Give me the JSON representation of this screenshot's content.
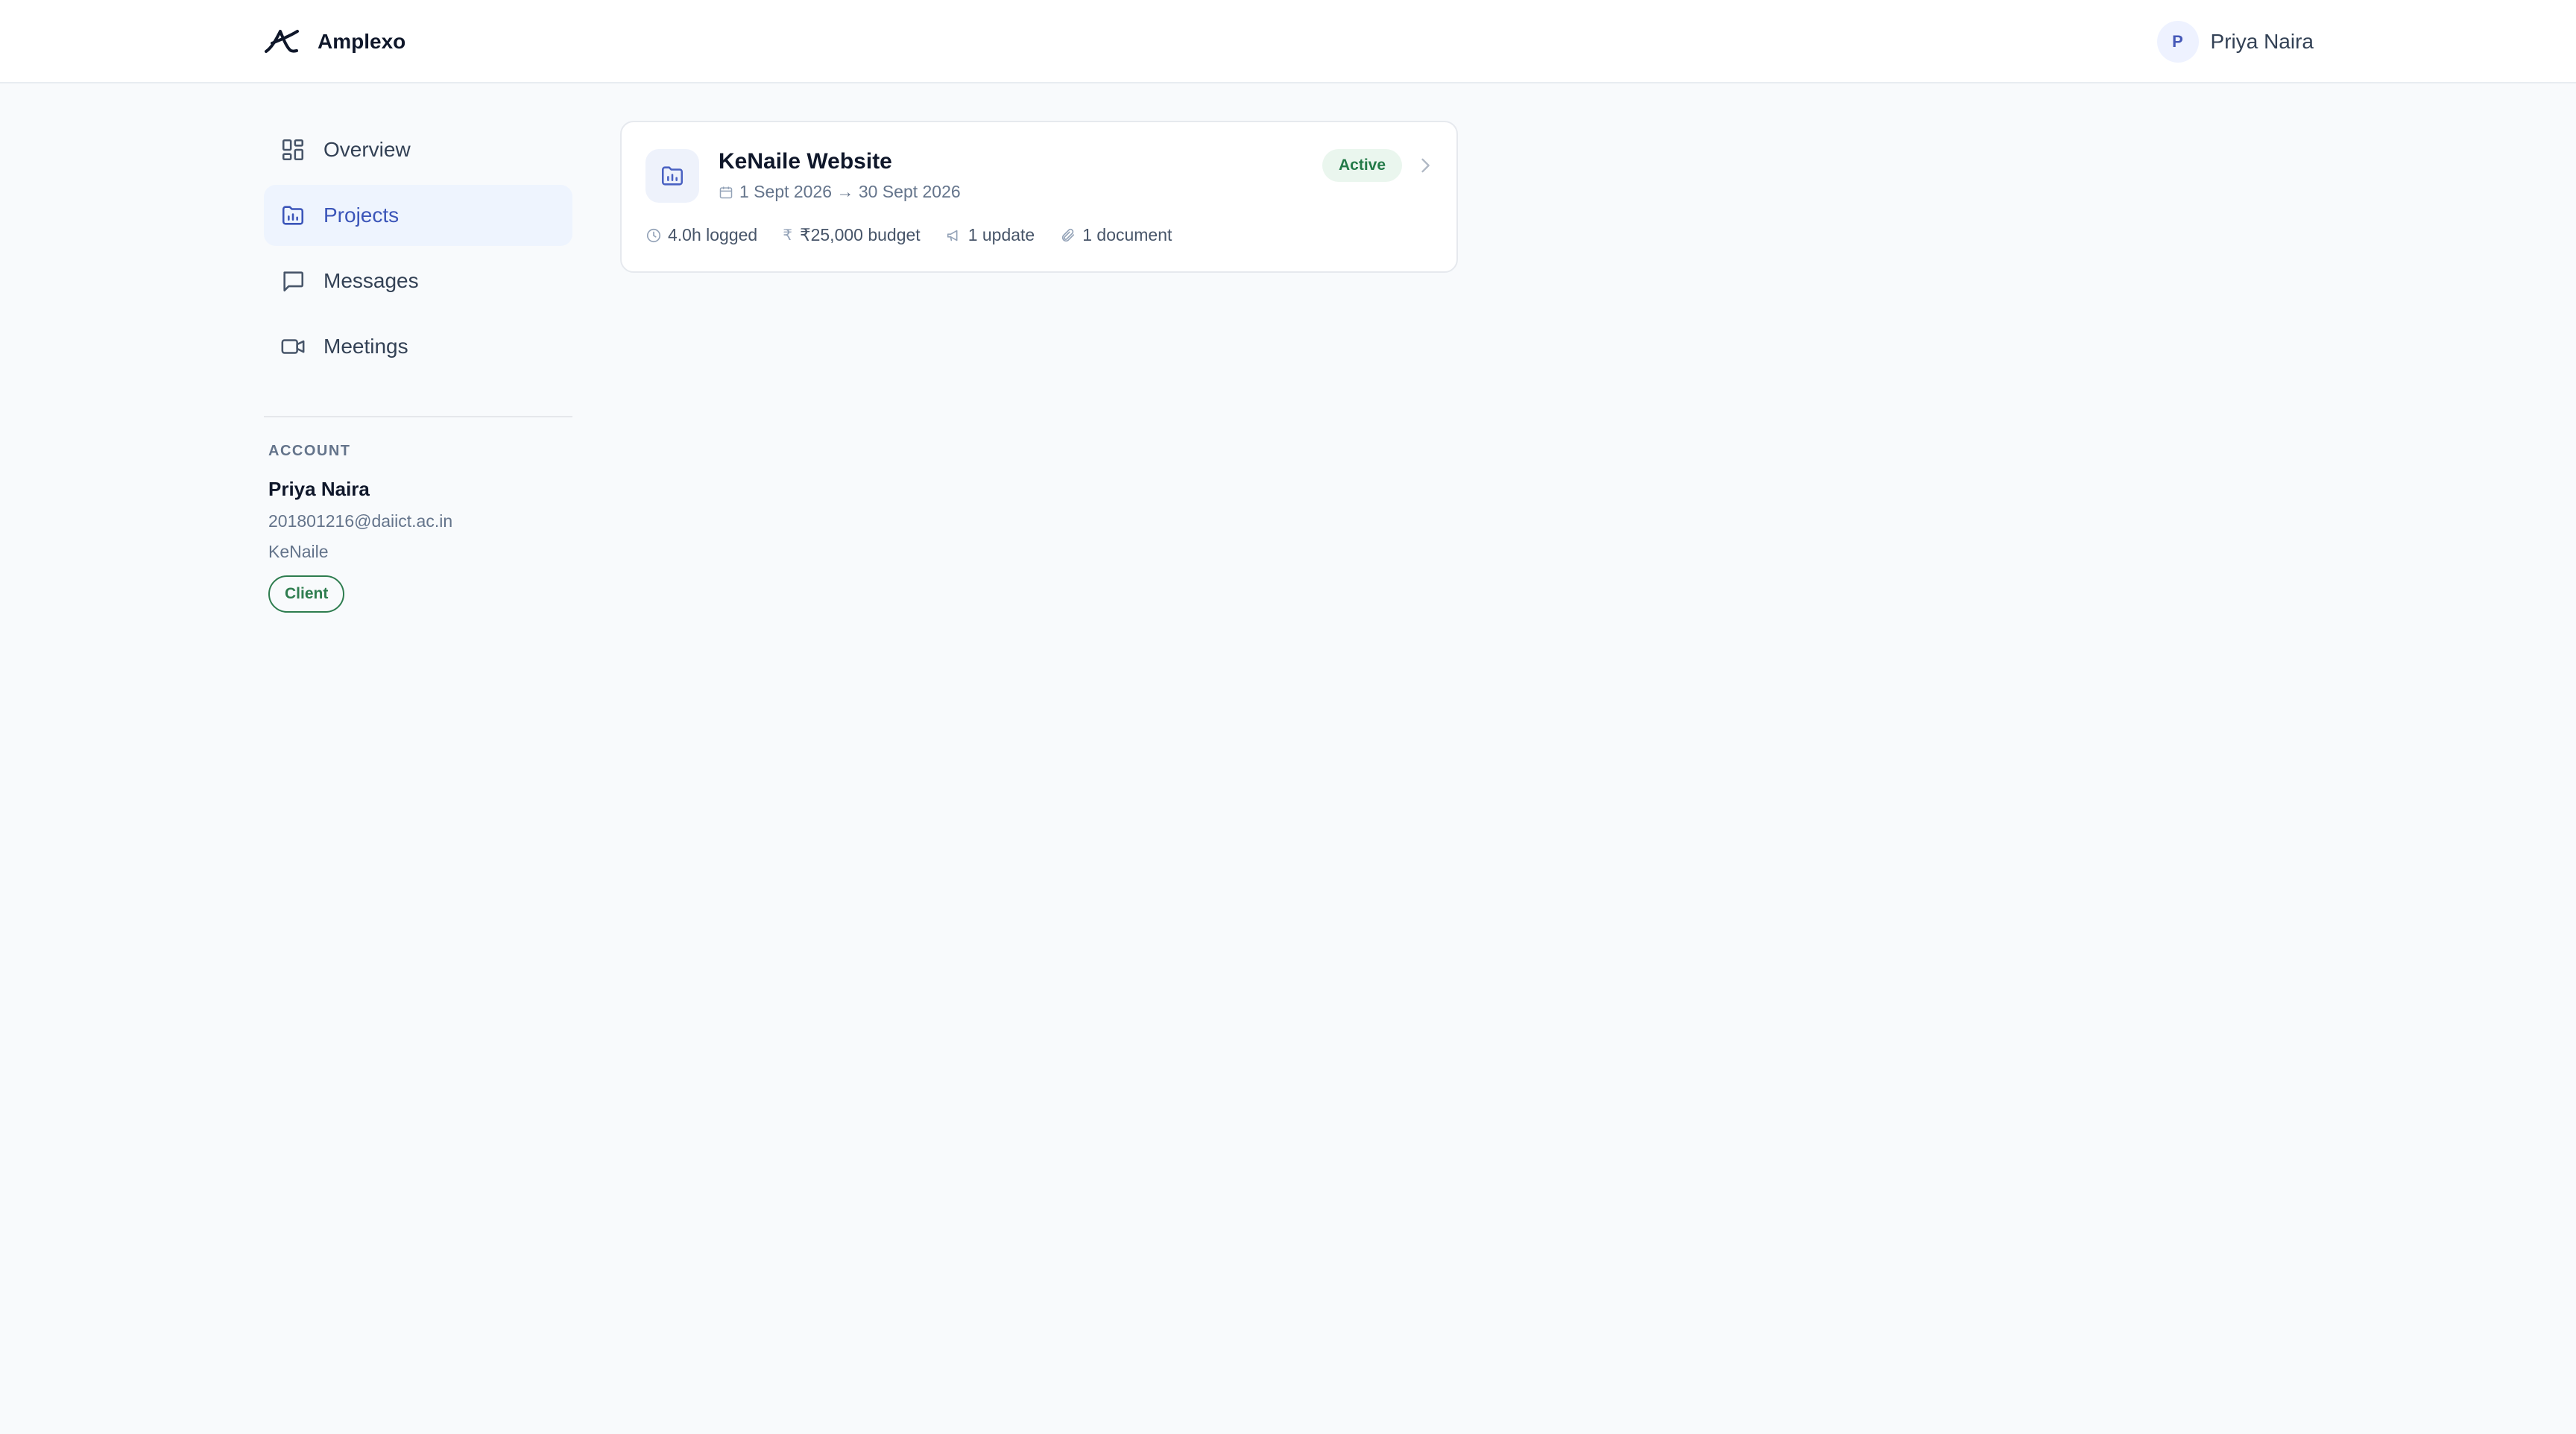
{
  "app": {
    "name": "Amplexo"
  },
  "header": {
    "user_initial": "P",
    "user_name": "Priya Naira"
  },
  "sidebar": {
    "items": [
      {
        "label": "Overview",
        "icon": "grid-icon",
        "active": false
      },
      {
        "label": "Projects",
        "icon": "folder-chart-icon",
        "active": true
      },
      {
        "label": "Messages",
        "icon": "message-icon",
        "active": false
      },
      {
        "label": "Meetings",
        "icon": "video-icon",
        "active": false
      }
    ]
  },
  "account": {
    "title": "ACCOUNT",
    "name": "Priya Naira",
    "email": "201801216@daiict.ac.in",
    "org": "KeNaile",
    "role": "Client"
  },
  "project": {
    "title": "KeNaile Website",
    "dates": "1 Sept 2026 → 30 Sept 2026",
    "status": "Active",
    "hours": "4.0h logged",
    "currency_symbol": "₹",
    "budget": "₹25,000 budget",
    "updates": "1 update",
    "documents": "1 document"
  },
  "colors": {
    "accent": "#3b55b9",
    "active_nav_bg": "#eef4fe",
    "status_green": "#237a48",
    "status_bg": "#eaf6ee",
    "role_green": "#2e7d4f"
  }
}
